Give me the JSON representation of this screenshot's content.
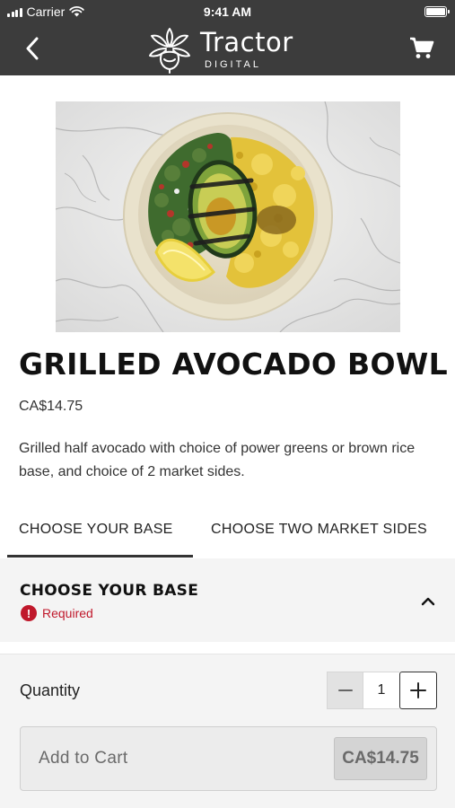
{
  "status_bar": {
    "carrier": "Carrier",
    "time": "9:41 AM"
  },
  "nav": {
    "back_icon": "chevron-left-icon",
    "brand_name": "Tractor",
    "brand_sub": "DIGITAL",
    "cart_icon": "cart-icon"
  },
  "product": {
    "name": "GRILLED AVOCADO BOWL",
    "price": "CA$14.75",
    "description": "Grilled half avocado with choice of power greens or brown rice base, and choice of 2 market sides."
  },
  "tabs": [
    {
      "label": "CHOOSE YOUR BASE",
      "active": true
    },
    {
      "label": "CHOOSE TWO MARKET SIDES",
      "active": false
    }
  ],
  "section": {
    "title": "CHOOSE YOUR BASE",
    "required_label": "Required",
    "expanded": true
  },
  "order": {
    "quantity_label": "Quantity",
    "quantity_value": "1",
    "add_to_cart_label": "Add to Cart",
    "add_to_cart_price": "CA$14.75"
  },
  "colors": {
    "header_bg": "#3c3c3c",
    "required": "#c0182b",
    "panel_bg": "#f4f4f4"
  }
}
